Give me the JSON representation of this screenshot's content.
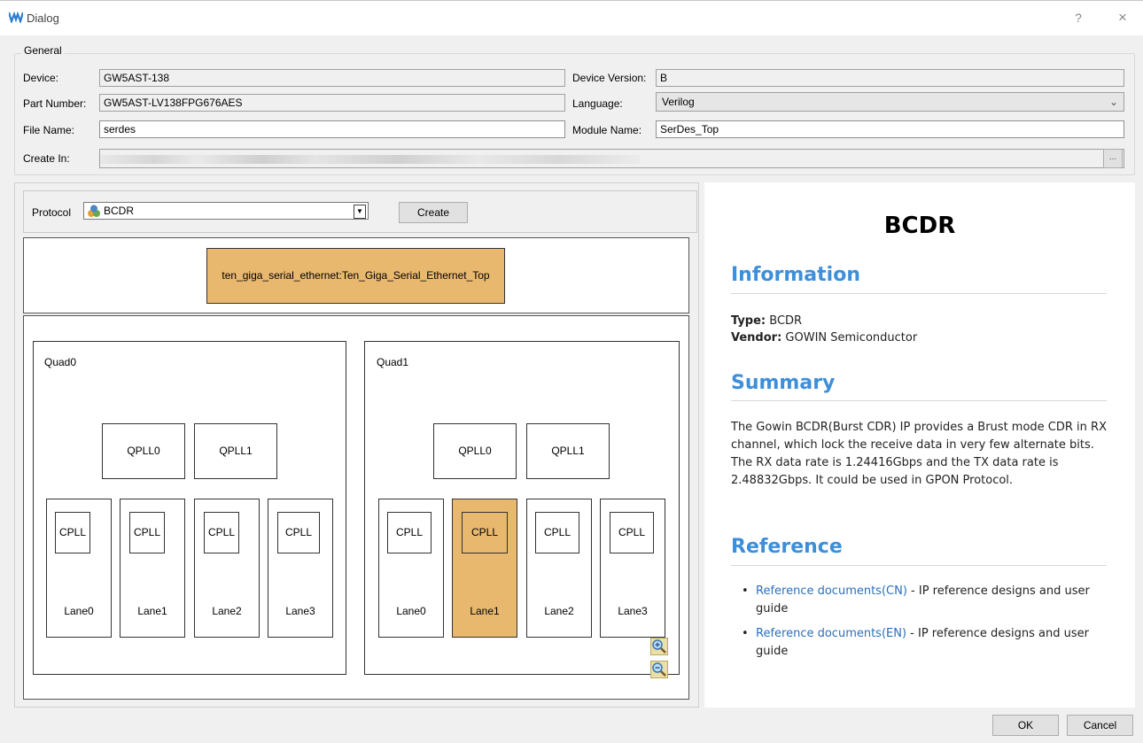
{
  "window": {
    "title": "Dialog",
    "help": "?",
    "close": "×"
  },
  "general": {
    "legend": "General",
    "device_label": "Device:",
    "device_value": "GW5AST-138",
    "device_version_label": "Device Version:",
    "device_version_value": "B",
    "part_number_label": "Part Number:",
    "part_number_value": "GW5AST-LV138FPG676AES",
    "language_label": "Language:",
    "language_value": "Verilog",
    "file_name_label": "File Name:",
    "file_name_value": "serdes",
    "module_name_label": "Module Name:",
    "module_name_value": "SerDes_Top",
    "create_in_label": "Create In:",
    "browse": "..."
  },
  "protocol": {
    "label": "Protocol",
    "value": "BCDR",
    "create": "Create"
  },
  "diagram": {
    "top_node": "ten_giga_serial_ethernet:Ten_Giga_Serial_Ethernet_Top",
    "quads": [
      {
        "name": "Quad0",
        "qpll": [
          "QPLL0",
          "QPLL1"
        ],
        "lanes": [
          {
            "cpll": "CPLL",
            "lane": "Lane0"
          },
          {
            "cpll": "CPLL",
            "lane": "Lane1"
          },
          {
            "cpll": "CPLL",
            "lane": "Lane2"
          },
          {
            "cpll": "CPLL",
            "lane": "Lane3"
          }
        ]
      },
      {
        "name": "Quad1",
        "qpll": [
          "QPLL0",
          "QPLL1"
        ],
        "lanes": [
          {
            "cpll": "CPLL",
            "lane": "Lane0"
          },
          {
            "cpll": "CPLL",
            "lane": "Lane1"
          },
          {
            "cpll": "CPLL",
            "lane": "Lane2"
          },
          {
            "cpll": "CPLL",
            "lane": "Lane3"
          }
        ]
      }
    ],
    "highlight_color": "#e8b86f"
  },
  "info": {
    "title": "BCDR",
    "information_heading": "Information",
    "type_label": "Type:",
    "type_value": "BCDR",
    "vendor_label": "Vendor:",
    "vendor_value": "GOWIN Semiconductor",
    "summary_heading": "Summary",
    "summary": "The Gowin BCDR(Burst CDR) IP provides a Brust mode CDR in RX channel, which lock the receive data in very few alternate bits. The RX data rate is 1.24416Gbps and the TX data rate is 2.48832Gbps. It could be used in GPON Protocol.",
    "reference_heading": "Reference",
    "ref1_link": "Reference documents(CN)",
    "ref1_text": " - IP reference designs and user guide",
    "ref2_link": "Reference documents(EN)",
    "ref2_text": " - IP reference designs and user guide",
    "heading_color": "#3d8fd9"
  },
  "buttons": {
    "ok": "OK",
    "cancel": "Cancel"
  }
}
